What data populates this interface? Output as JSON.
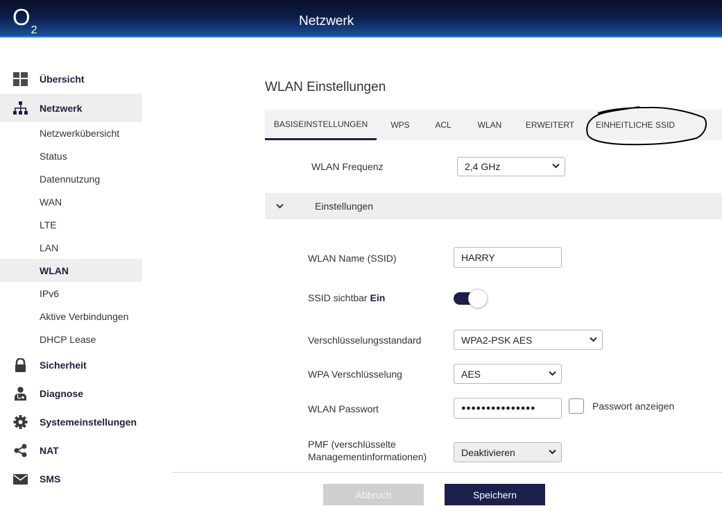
{
  "header": {
    "logo_text": "O",
    "logo_sub": "2",
    "title": "Netzwerk"
  },
  "sidebar": {
    "items": [
      {
        "label": "Übersicht",
        "icon": "grid-icon"
      },
      {
        "label": "Netzwerk",
        "icon": "network-tree-icon"
      },
      {
        "label": "Sicherheit",
        "icon": "lock-icon"
      },
      {
        "label": "Diagnose",
        "icon": "doctor-icon"
      },
      {
        "label": "Systemeinstellungen",
        "icon": "gear-icon"
      },
      {
        "label": "NAT",
        "icon": "share-icon"
      },
      {
        "label": "SMS",
        "icon": "envelope-icon"
      }
    ],
    "sub_items": [
      {
        "label": "Netzwerkübersicht"
      },
      {
        "label": "Status"
      },
      {
        "label": "Datennutzung"
      },
      {
        "label": "WAN"
      },
      {
        "label": "LTE"
      },
      {
        "label": "LAN"
      },
      {
        "label": "WLAN"
      },
      {
        "label": "IPv6"
      },
      {
        "label": "Aktive Verbindungen"
      },
      {
        "label": "DHCP Lease"
      }
    ],
    "active_item": "Netzwerk",
    "active_sub_item": "WLAN"
  },
  "main": {
    "title": "WLAN Einstellungen",
    "tabs": [
      {
        "label": "BASISEINSTELLUNGEN"
      },
      {
        "label": "WPS"
      },
      {
        "label": "ACL"
      },
      {
        "label": "WLAN"
      },
      {
        "label": "ERWEITERT"
      },
      {
        "label": "EINHEITLICHE SSID"
      }
    ],
    "active_tab": "BASISEINSTELLUNGEN",
    "frequency": {
      "label": "WLAN Frequenz",
      "value": "2,4 GHz"
    },
    "section": {
      "label": "Einstellungen"
    },
    "ssid": {
      "label": "WLAN Name (SSID)",
      "value": "HARRY"
    },
    "ssid_visible": {
      "label": "SSID sichtbar",
      "state": "Ein"
    },
    "encryption_standard": {
      "label": "Verschlüsselungsstandard",
      "value": "WPA2-PSK AES"
    },
    "wpa_encryption": {
      "label": "WPA Verschlüsselung",
      "value": "AES"
    },
    "password": {
      "label": "WLAN Passwort",
      "value": "●●●●●●●●●●●●●●●",
      "show_label": "Passwort anzeigen"
    },
    "pmf": {
      "label_line1": "PMF (verschlüsselte",
      "label_line2": "Managementinformationen)",
      "value": "Deaktivieren"
    }
  },
  "footer": {
    "cancel_label": "Abbruch",
    "save_label": "Speichern"
  },
  "colors": {
    "brand_navy": "#1b1f4a",
    "header_dark": "#0a0f2a",
    "header_blue": "#1a5ba8",
    "active_bg": "#eeeeee"
  }
}
